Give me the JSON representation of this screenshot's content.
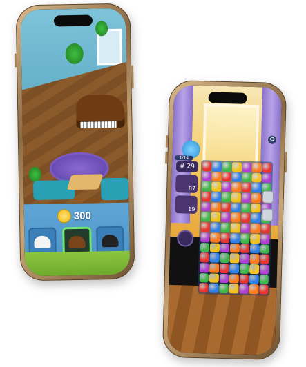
{
  "left_phone": {
    "coins": {
      "value": "300",
      "icon": "coin-icon"
    },
    "shop_slots": [
      {
        "name": "white-grand-piano",
        "color": "#f4f4f4",
        "selected": false
      },
      {
        "name": "brown-grand-piano",
        "color": "#7a4518",
        "selected": true
      },
      {
        "name": "black-grand-piano",
        "color": "#222222",
        "selected": false
      }
    ]
  },
  "right_phone": {
    "level": "1/14",
    "moves": "29",
    "goal_count": "87",
    "booster_count": "19",
    "icons": [
      "gear-icon",
      "lock-icon",
      "lock-icon",
      "mascot-icon"
    ],
    "gem_colors": [
      "#e8332f",
      "#2f7fe8",
      "#3fb84a",
      "#f3c21a",
      "#b23fd1",
      "#ff7a1a"
    ]
  }
}
